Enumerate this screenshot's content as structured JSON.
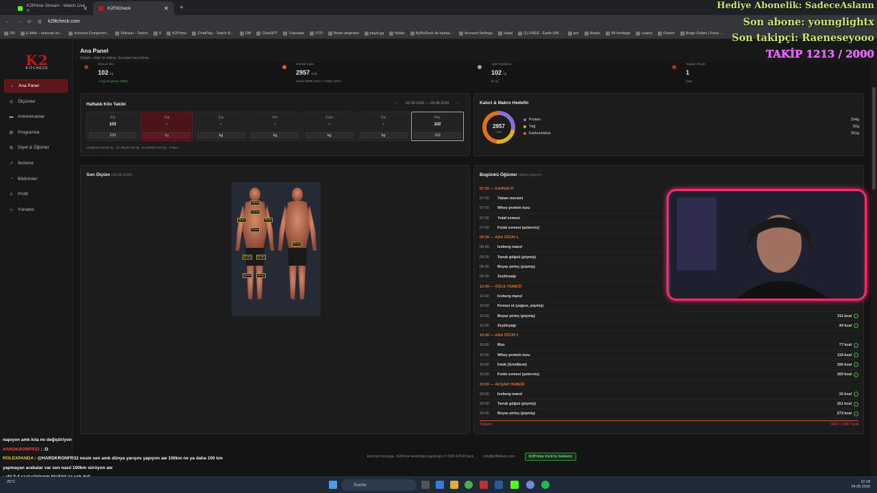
{
  "browser": {
    "tabs": [
      {
        "label": "K2Prime Stream - Watch Live o",
        "active": false
      },
      {
        "label": "K2FitCheck",
        "active": true
      }
    ],
    "url": "k2fitcheck.com",
    "bookmarks": [
      "DR",
      "E-Mail – emircan ko…",
      "Account Compromi…",
      "Eldraun - Twitch",
      "X",
      "K2Prime",
      "ChatPlay - Twitch B…",
      "DM",
      "ChatGPT",
      "Translate",
      "STD",
      "Besin degerleri",
      "playit.gg",
      "Notlar",
      "ByNoDeck ile harika…",
      "Account Settings",
      "Hatal",
      "(1) FREE - Earth-SM…",
      "pro",
      "Aladyr",
      "Mi Heritage",
      "Lisans",
      "Flower",
      "Bolge Online | Fens…"
    ]
  },
  "sidebar": {
    "logo": "K2",
    "logo_sub": "FITCHECK",
    "items": [
      {
        "label": "Ana Panel",
        "icon": "home-icon",
        "active": true
      },
      {
        "label": "Ölçümler",
        "icon": "ruler-icon"
      },
      {
        "label": "Antrenmanlar",
        "icon": "dumbbell-icon"
      },
      {
        "label": "Programlar",
        "icon": "calendar-icon"
      },
      {
        "label": "Diyet & Öğünler",
        "icon": "diet-icon"
      },
      {
        "label": "İlerleme",
        "icon": "chart-icon"
      },
      {
        "label": "Bildirimler",
        "icon": "bell-icon"
      },
      {
        "label": "Profil",
        "icon": "user-icon"
      },
      {
        "label": "Yönetim",
        "icon": "admin-icon"
      }
    ]
  },
  "header": {
    "title": "Ana Panel",
    "subtitle": "Disiplin, odak ve istikrar. Sonuçlar kaçınılmaz."
  },
  "stats": [
    {
      "label": "Güncel Kilo",
      "value": "102",
      "unit": "kg",
      "note": "-1 kg (vs geçen hafta)",
      "note_color": "#4caf50",
      "color": "#b03030"
    },
    {
      "label": "Günlük Kalori",
      "value": "2957",
      "unit": "kcal",
      "note": "Hedef (BMR 2004 × TDEE 3457)",
      "color": "#e06020"
    },
    {
      "label": "Aylık Ortalama",
      "value": "102",
      "unit": "kg",
      "note": "İlk ay",
      "color": "#aaa"
    },
    {
      "label": "Toplam Ölçüm",
      "value": "1",
      "unit": "",
      "note": "kayıt",
      "color": "#b03030"
    }
  ],
  "weekly": {
    "title": "Haftalık Kilo Takibi",
    "range": "03.08.2026 — 09.08.2026",
    "prev": "←",
    "next": "→",
    "days": [
      {
        "name": "Pzt",
        "value": "103",
        "input": "103"
      },
      {
        "name": "Sal",
        "value": "-",
        "input": "kg",
        "selected": true
      },
      {
        "name": "Çar",
        "value": "-",
        "input": "kg"
      },
      {
        "name": "Per",
        "value": "-",
        "input": "kg"
      },
      {
        "name": "Cum",
        "value": "-",
        "input": "kg"
      },
      {
        "name": "Cts",
        "value": "-",
        "input": "kg"
      },
      {
        "name": "Paz",
        "value": "102",
        "input": "102",
        "today": true
      }
    ],
    "note": "Ortalama 102.50 kg · En düşük 102 kg · En yüksek 103 kg · 2 kayıt"
  },
  "macros": {
    "title": "Kalori & Makro Hedefin",
    "total": "2957",
    "total_unit": "kcal",
    "items": [
      {
        "name": "Protein",
        "value": "204g",
        "grams": 204,
        "color": "#8a6dd8"
      },
      {
        "name": "Yağ",
        "value": "82g",
        "grams": 82,
        "color": "#e0b020"
      },
      {
        "name": "Karbonhidrat",
        "value": "351g",
        "grams": 351,
        "color": "#e07020"
      }
    ]
  },
  "measure": {
    "title": "Son Ölçüm",
    "date": "(09.08.2026)",
    "tags": [
      "106 cm",
      "38 cm",
      "102 cm",
      "38 cm",
      "92 cm",
      "62 cm",
      "62 cm",
      "40 cm",
      "40 cm",
      "92 cm"
    ]
  },
  "meals": {
    "title": "Bugünkü Öğünler",
    "subtitle": "(favori planın)",
    "groups": [
      {
        "header": "07:00 — KAHVALTI",
        "items": [
          {
            "time": "07:00",
            "name": "Yaban mersini",
            "kcal": ""
          },
          {
            "time": "07:00",
            "name": "Whey protein tozu",
            "kcal": ""
          },
          {
            "time": "07:00",
            "name": "Yulaf ezmesi",
            "kcal": ""
          },
          {
            "time": "07:00",
            "name": "Fıstık ezmesi (şekersiz)",
            "kcal": ""
          }
        ]
      },
      {
        "header": "09:30 — ARA ÖĞÜN 1",
        "items": [
          {
            "time": "09:30",
            "name": "Iceberg marul",
            "kcal": ""
          },
          {
            "time": "09:30",
            "name": "Tavuk göğsü (pişmiş)",
            "kcal": ""
          },
          {
            "time": "09:30",
            "name": "Beyaz pirinç (pişmiş)",
            "kcal": ""
          },
          {
            "time": "09:30",
            "name": "Zeytinyağı",
            "kcal": ""
          }
        ]
      },
      {
        "header": "12:00 — ÖĞLE YEMEĞİ",
        "items": [
          {
            "time": "12:00",
            "name": "Iceberg marul",
            "kcal": ""
          },
          {
            "time": "12:00",
            "name": "Kırmızı et (yağsız, pişmiş)",
            "kcal": ""
          },
          {
            "time": "12:00",
            "name": "Beyaz pirinç (pişmiş)",
            "kcal": "311 kcal"
          },
          {
            "time": "12:00",
            "name": "Zeytinyağı",
            "kcal": "44 kcal"
          }
        ]
      },
      {
        "header": "16:00 — ARA ÖĞÜN 2",
        "items": [
          {
            "time": "16:00",
            "name": "Muz",
            "kcal": "77 kcal"
          },
          {
            "time": "16:00",
            "name": "Whey protein tozu",
            "kcal": "119 kcal"
          },
          {
            "time": "16:00",
            "name": "İrmik (Grießbrei)",
            "kcal": "156 kcal"
          },
          {
            "time": "16:00",
            "name": "Fıstık ezmesi (şekersiz)",
            "kcal": "160 kcal"
          }
        ]
      },
      {
        "header": "20:00 — AKŞAM YEMEĞİ",
        "items": [
          {
            "time": "20:00",
            "name": "Iceberg marul",
            "kcal": "15 kcal"
          },
          {
            "time": "20:00",
            "name": "Tavuk göğsü (pişmiş)",
            "kcal": "161 kcal"
          },
          {
            "time": "20:00",
            "name": "Beyaz pirinç (pişmiş)",
            "kcal": "273 kcal"
          }
        ]
      }
    ],
    "total_label": "Toplam",
    "total_value": "3007 / 2957 kcal"
  },
  "footer": {
    "text": "Emircan Kockaya - K2Prime tarafından yapılmıştır © 2026 K2FitCheck",
    "email": "info@k2fitcheck.com",
    "button": "K2Prime Kick'te bekleriz"
  },
  "overlay": {
    "line1": "Hediye Abonelik: SadeceAslann",
    "line2": "Son abone: younglightx",
    "line3": "Son takipçi: Raeneseyooo",
    "line4": "TAKİP 1213 / 2000"
  },
  "chat": [
    {
      "user": "",
      "text": "napıyon amk kıta mı değiştiriyon"
    },
    {
      "user": "HARDKRONFR32",
      "text": ": :D"
    },
    {
      "user": "ROLEXPANDA",
      "text": ": @HARDKRONFR32 nesin sen amk dünya yarışını yapıyon aw 100km ne ya daha 100 km yapmayan arabalar var sen nasıl 100km sürüyon aw"
    },
    {
      "user": "",
      "text": ": abi 3-4 saat sürüyom bisiklet ya çok deli"
    },
    {
      "user": "HARDKRONFR32",
      "text": ": :D"
    }
  ],
  "taskbar": {
    "search": "Suche",
    "weather": "25°C",
    "time": "22:18",
    "date": "04.08.2026"
  }
}
